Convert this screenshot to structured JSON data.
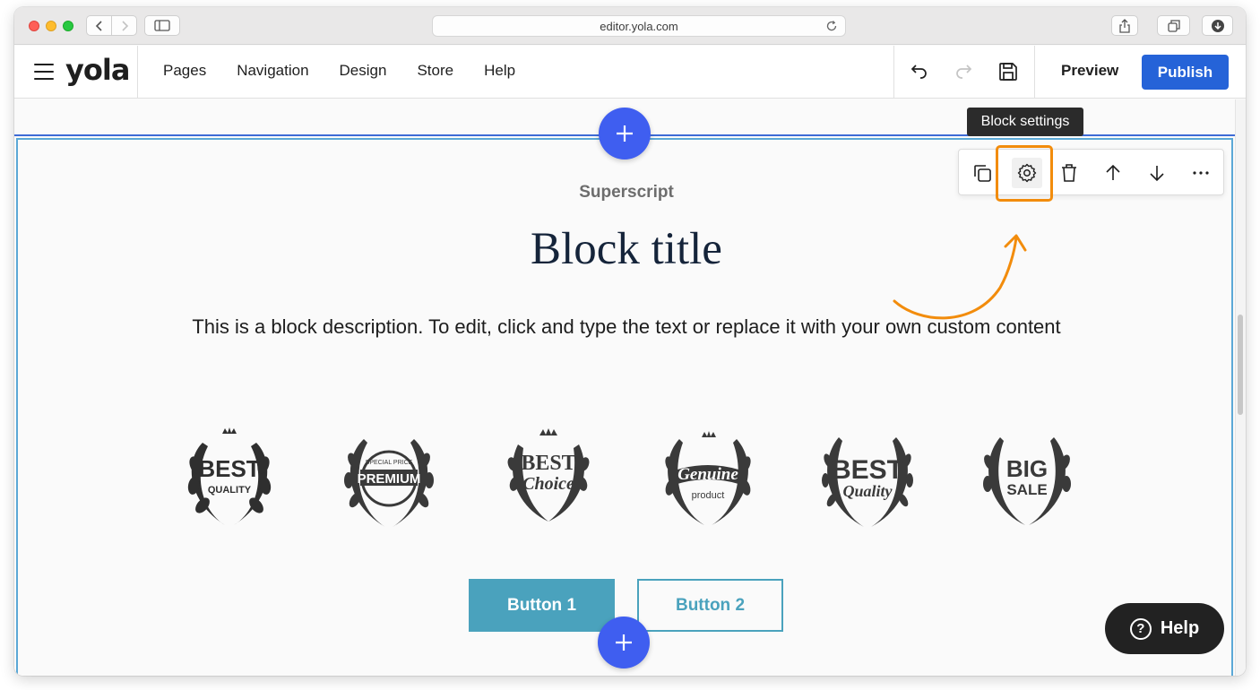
{
  "browser": {
    "url": "editor.yola.com"
  },
  "header": {
    "logo": "yola",
    "menu": [
      "Pages",
      "Navigation",
      "Design",
      "Store",
      "Help"
    ],
    "preview_label": "Preview",
    "publish_label": "Publish"
  },
  "block": {
    "superscript": "Superscript",
    "title": "Block title",
    "description": "This is a block description. To edit, click and type the text or replace it with your own custom content",
    "badges": [
      {
        "line1": "BEST",
        "line2": "QUALITY"
      },
      {
        "line1": "PREMIUM",
        "line2": "SPECIAL PRICE"
      },
      {
        "line1": "BEST",
        "line2": "Choice"
      },
      {
        "line1": "Genuine",
        "line2": "product"
      },
      {
        "line1": "BEST",
        "line2": "Quality"
      },
      {
        "line1": "BIG",
        "line2": "SALE"
      }
    ],
    "button1_label": "Button 1",
    "button2_label": "Button 2"
  },
  "toolbar": {
    "tooltip": "Block settings",
    "icons": [
      "copy-icon",
      "gear-icon",
      "trash-icon",
      "arrow-up-icon",
      "arrow-down-icon",
      "more-icon"
    ]
  },
  "help_widget": {
    "label": "Help"
  },
  "colors": {
    "publish": "#2563d8",
    "accent_button": "#4aa2bd",
    "add_button": "#3f5ef0",
    "highlight": "#f28c0c"
  }
}
